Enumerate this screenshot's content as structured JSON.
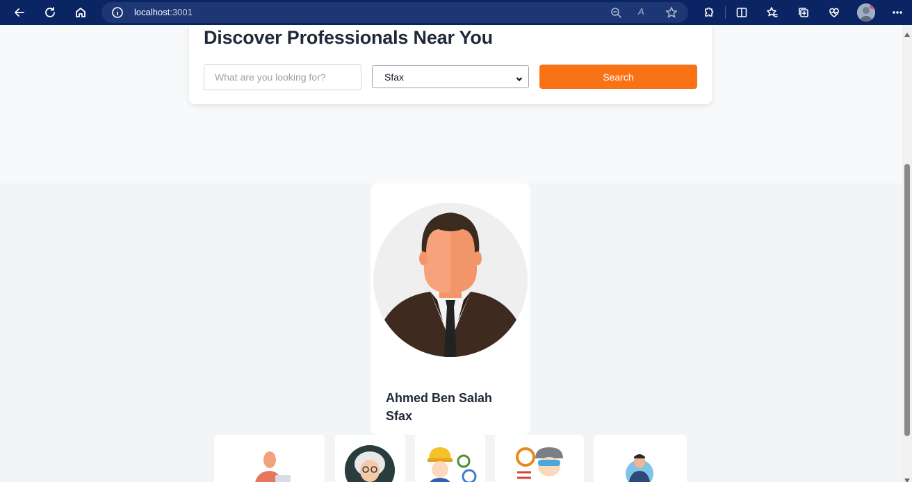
{
  "browser": {
    "url_host": "localhost",
    "url_port": ":3001",
    "read_aloud_label": "A"
  },
  "search": {
    "title": "Discover Professionals Near You",
    "query_placeholder": "What are you looking for?",
    "query_value": "",
    "city_selected": "Sfax",
    "button_label": "Search"
  },
  "featured": {
    "name": "Ahmed Ben Salah",
    "city": "Sfax"
  },
  "colors": {
    "accent": "#f97316",
    "browser_bar": "#0b2463",
    "text_dark": "#1f2937"
  },
  "icons": [
    "back-icon",
    "refresh-icon",
    "home-icon",
    "info-icon",
    "zoom-out-icon",
    "read-aloud-icon",
    "favorite-star-icon",
    "extensions-icon",
    "split-screen-icon",
    "favorites-icon",
    "collections-icon",
    "performance-icon",
    "more-icon"
  ]
}
